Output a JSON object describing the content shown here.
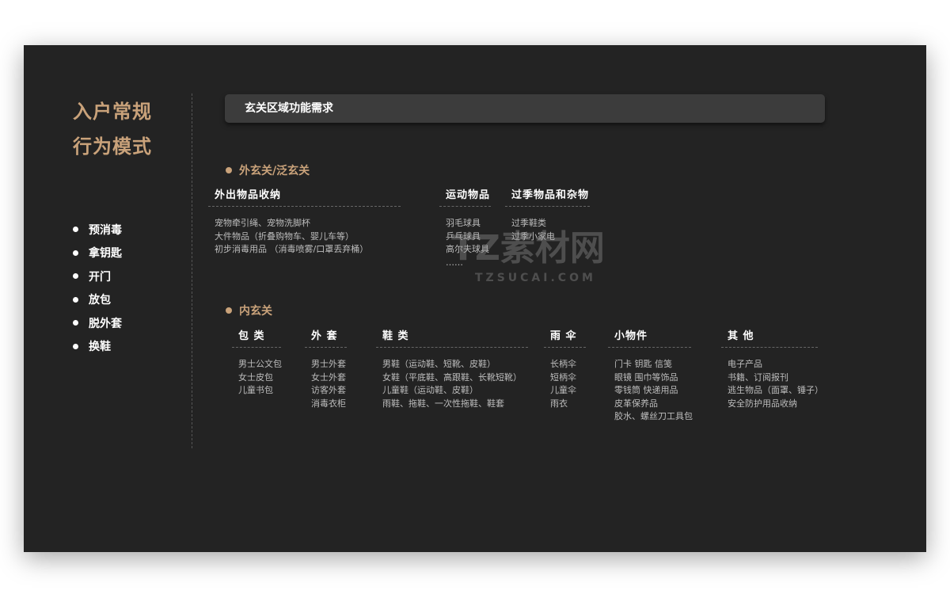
{
  "sidebar": {
    "title_line1": "入户常规",
    "title_line2": "行为模式",
    "steps": [
      "预消毒",
      "拿钥匙",
      "开门",
      "放包",
      "脱外套",
      "换鞋"
    ]
  },
  "header": {
    "title": "玄关区域功能需求"
  },
  "outer": {
    "label": "外玄关/泛玄关",
    "groups": [
      {
        "title": "外出物品收纳",
        "items": [
          "宠物牵引绳、宠物洗脚杯",
          "大件物品（折叠购物车、婴儿车等）",
          "初步消毒用品 （消毒喷雾/口罩丢弃桶）"
        ]
      },
      {
        "title": "运动物品",
        "items": [
          "羽毛球具",
          "乒乓球具",
          "高尔夫球具",
          "……"
        ]
      },
      {
        "title": "过季物品和杂物",
        "items": [
          "过季鞋类",
          "过季小家电"
        ]
      }
    ]
  },
  "inner": {
    "label": "内玄关",
    "groups": [
      {
        "title": "包 类",
        "items": [
          "男士公文包",
          "女士皮包",
          "儿童书包"
        ]
      },
      {
        "title": "外 套",
        "items": [
          "男士外套",
          "女士外套",
          "访客外套",
          "消毒衣柜"
        ]
      },
      {
        "title": "鞋 类",
        "items": [
          "男鞋（运动鞋、短靴、皮鞋）",
          "女鞋（平底鞋、高跟鞋、长靴短靴）",
          "儿童鞋（运动鞋、皮鞋）",
          "雨鞋、拖鞋、一次性拖鞋、鞋套"
        ]
      },
      {
        "title": "雨 伞",
        "items": [
          "长柄伞",
          "短柄伞",
          "儿童伞",
          "雨衣"
        ]
      },
      {
        "title": "小物件",
        "items": [
          "门卡 钥匙 信笺",
          "眼镜 围巾等饰品",
          "零钱筒 快递用品",
          "皮革保养品",
          "胶水、螺丝刀工具包"
        ]
      },
      {
        "title": "其 他",
        "items": [
          "电子产品",
          "书籍、订阅报刊",
          "逃生物品（面罩、锤子）",
          "安全防护用品收纳"
        ]
      }
    ]
  },
  "watermark": {
    "brand": "TZ素材网",
    "url": "TZSUCAI.COM"
  }
}
